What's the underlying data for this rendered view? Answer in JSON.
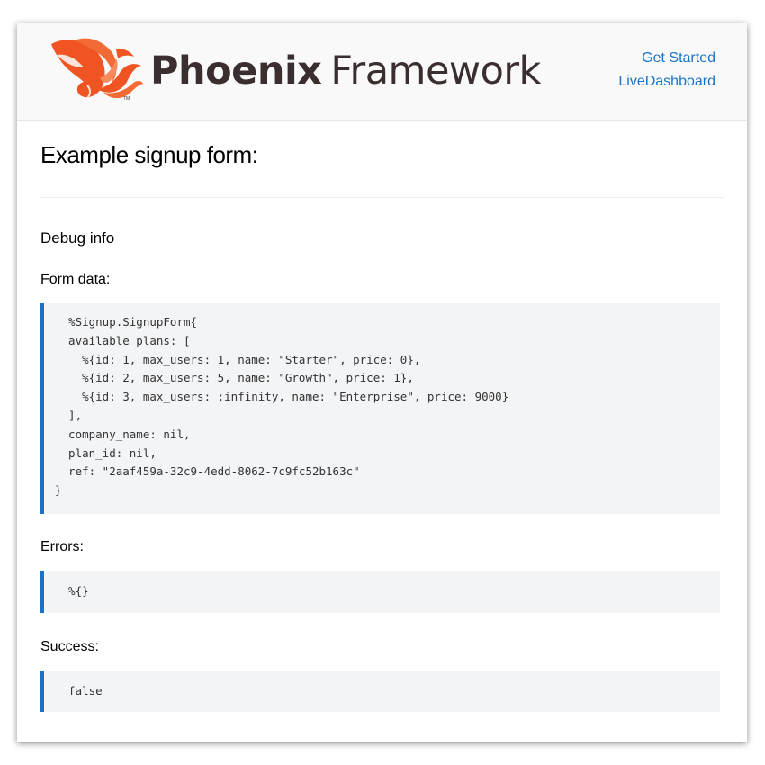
{
  "header": {
    "logo": {
      "word_bold": "Phoenix",
      "word_light": "Framework",
      "trademark": "TM"
    },
    "nav": [
      {
        "label": "Get Started"
      },
      {
        "label": "LiveDashboard"
      }
    ]
  },
  "main": {
    "title": "Example signup form:",
    "debug_heading": "Debug info",
    "form_data_label": "Form data:",
    "form_data_value": "  %Signup.SignupForm{\n  available_plans: [\n    %{id: 1, max_users: 1, name: \"Starter\", price: 0},\n    %{id: 2, max_users: 5, name: \"Growth\", price: 1},\n    %{id: 3, max_users: :infinity, name: \"Enterprise\", price: 9000}\n  ],\n  company_name: nil,\n  plan_id: nil,\n  ref: \"2aaf459a-32c9-4edd-8062-7c9fc52b163c\"\n}",
    "errors_label": "Errors:",
    "errors_value": "  %{}",
    "success_label": "Success:",
    "success_value": "  false"
  },
  "colors": {
    "link": "#1a73c9",
    "brand_flame": "#f05423",
    "brand_text": "#3a2f2e",
    "code_bg": "#f3f4f6"
  }
}
